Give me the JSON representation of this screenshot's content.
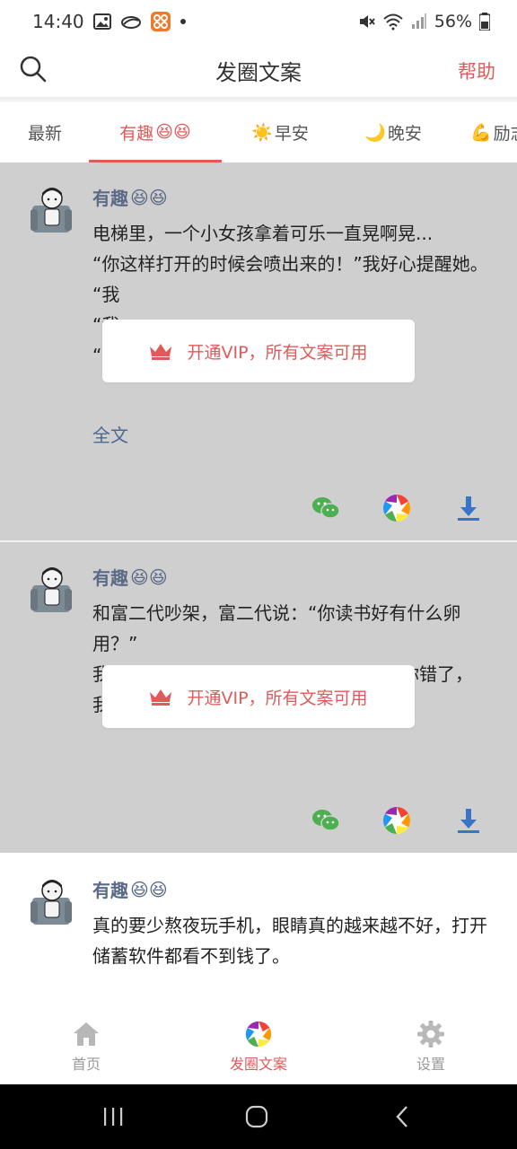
{
  "status_bar": {
    "time": "14:40",
    "battery": "56%",
    "icons": [
      "gallery-icon",
      "cloud-icon",
      "app-icon",
      "dot-icon",
      "mute-icon",
      "wifi-icon",
      "signal-icon",
      "battery-icon"
    ]
  },
  "header": {
    "title": "发圈文案",
    "help_label": "帮助",
    "search_icon": "search-icon"
  },
  "tabs": [
    {
      "label": "最新",
      "emoji": "",
      "active": false
    },
    {
      "label": "有趣",
      "emoji": "😆😆",
      "active": true
    },
    {
      "label": "早安",
      "emoji": "☀️",
      "active": false
    },
    {
      "label": "晚安",
      "emoji": "🌙",
      "active": false
    },
    {
      "label": "励志",
      "emoji": "💪",
      "active": false
    }
  ],
  "cards": [
    {
      "tag": "有趣",
      "tag_emoji": "😆😆",
      "locked": true,
      "lines": [
        "电梯里，一个小女孩拿着可乐一直晃啊晃...",
        "“你这样打开的时候会喷出来的！”我好心提醒她。",
        "“我",
        "“我",
        "“我给我哥买的...”"
      ],
      "more_label": "全文",
      "vip_text": "开通VIP，所有文案可用"
    },
    {
      "tag": "有趣",
      "tag_emoji": "😆😆",
      "locked": true,
      "lines": [
        "和富二代吵架，富二代说：“你读书好有什么卵用？”",
        "我",
        "你错了，",
        "我"
      ],
      "vip_text": "开通VIP，所有文案可用"
    },
    {
      "tag": "有趣",
      "tag_emoji": "😆😆",
      "locked": false,
      "lines": [
        "真的要少熬夜玩手机，眼睛真的越来越不好，打开储蓄软件都看不到钱了。"
      ]
    }
  ],
  "bottom_nav": [
    {
      "label": "首页",
      "icon": "home-icon",
      "active": false
    },
    {
      "label": "发圈文案",
      "icon": "aperture-icon",
      "active": true
    },
    {
      "label": "设置",
      "icon": "gear-icon",
      "active": false
    }
  ],
  "colors": {
    "accent": "#e05a5a",
    "tag": "#5b6b86",
    "link": "#4b6a93",
    "locked_bg": "#cfcfcf",
    "wechat": "#4caf50",
    "download": "#3a74c9"
  }
}
